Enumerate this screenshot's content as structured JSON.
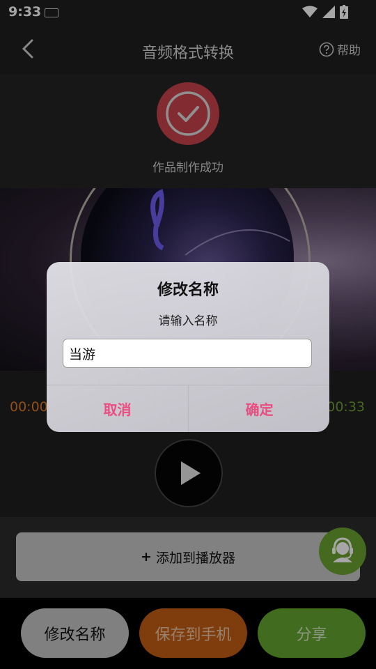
{
  "status_bar": {
    "time": "9:33"
  },
  "app_bar": {
    "title": "音频格式转换",
    "help_label": "帮助"
  },
  "success": {
    "message": "作品制作成功"
  },
  "player": {
    "current_time": "00:00",
    "total_time": "00:33"
  },
  "add_to_player": {
    "label": "添加到播放器",
    "prefix": "+"
  },
  "bottom_actions": {
    "rename_label": "修改名称",
    "save_label": "保存到手机",
    "share_label": "分享"
  },
  "dialog": {
    "title": "修改名称",
    "message": "请输入名称",
    "input_value": "当游",
    "cancel_label": "取消",
    "confirm_label": "确定"
  },
  "colors": {
    "accent_pink": "#ea4d80",
    "success_red": "#c8424c",
    "orange": "#c45f14",
    "green": "#64a52f"
  }
}
